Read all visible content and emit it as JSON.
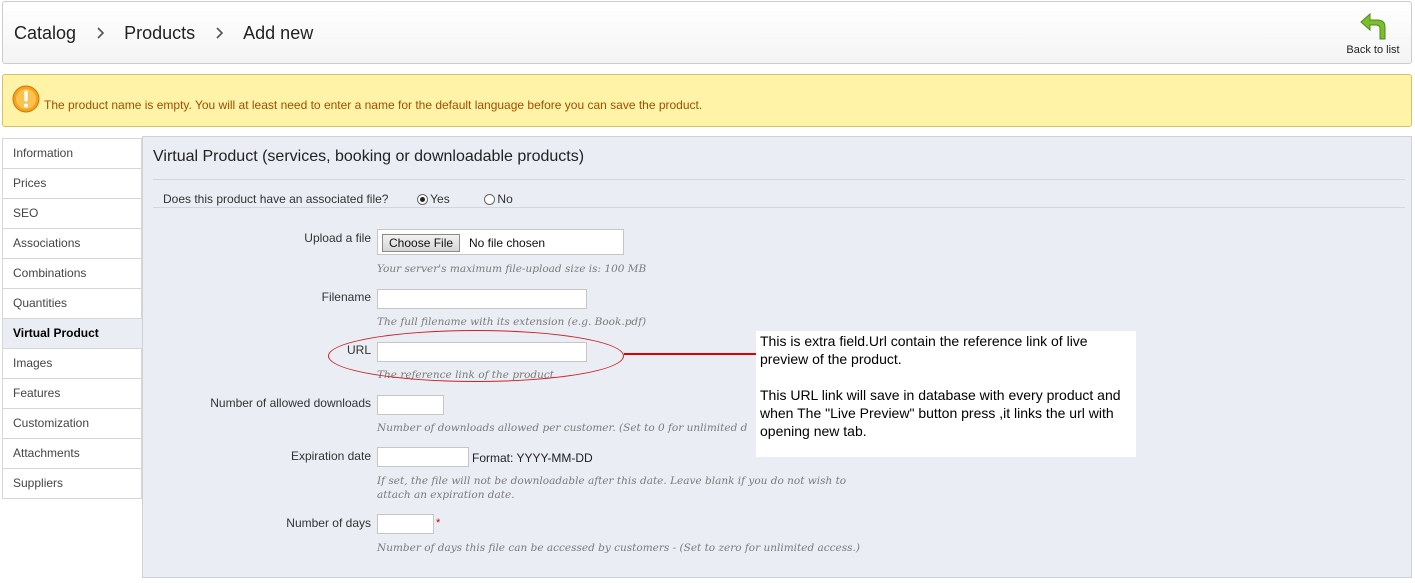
{
  "header": {
    "breadcrumb": [
      "Catalog",
      "Products",
      "Add new"
    ],
    "back_label": "Back to list"
  },
  "warning": {
    "message": "The product name is empty. You will at least need to enter a name for the default language before you can save the product."
  },
  "sidebar": {
    "active": "Virtual Product",
    "items": [
      "Information",
      "Prices",
      "SEO",
      "Associations",
      "Combinations",
      "Quantities",
      "Virtual Product",
      "Images",
      "Features",
      "Customization",
      "Attachments",
      "Suppliers"
    ]
  },
  "panel": {
    "title": "Virtual Product (services, booking or downloadable products)",
    "associated_question": "Does this product have an associated file?",
    "yes_label": "Yes",
    "no_label": "No",
    "selected": "Yes",
    "upload": {
      "label": "Upload a file",
      "button": "Choose File",
      "status": "No file chosen",
      "hint": "Your server's maximum file-upload size is: 100 MB"
    },
    "filename": {
      "label": "Filename",
      "value": "",
      "hint": "The full filename with its extension (e.g. Book.pdf)"
    },
    "url": {
      "label": "URL",
      "value": "",
      "hint": "The reference link of the product"
    },
    "downloads": {
      "label": "Number of allowed downloads",
      "value": "",
      "hint": "Number of downloads allowed per customer. (Set to 0 for unlimited d"
    },
    "expiration": {
      "label": "Expiration date",
      "value": "",
      "format": "Format: YYYY-MM-DD",
      "hint_line1": "If set, the file will not be downloadable after this date. Leave blank if you do not wish to",
      "hint_line2": "attach an expiration date."
    },
    "days": {
      "label": "Number of days",
      "value": "",
      "required_mark": "*",
      "hint": "Number of days this file can be accessed by customers - (Set to zero for unlimited access.)"
    }
  },
  "annotation": {
    "paragraph1": "This is extra field.Url contain the reference link of live preview of the product.",
    "paragraph2": "This URL link will save in database with every product and when The \"Live Preview\" button press ,it links the url with opening new tab."
  },
  "colors": {
    "warning_bg": "#fff3a8",
    "warning_text": "#a24e00",
    "panel_bg": "#eaedf3",
    "annotation_red": "#dd0000",
    "back_arrow": "#6aa321"
  },
  "icons": {
    "back": "back-arrow-icon",
    "warning": "exclamation-icon",
    "breadcrumb_separator": "chevron-right-icon"
  }
}
